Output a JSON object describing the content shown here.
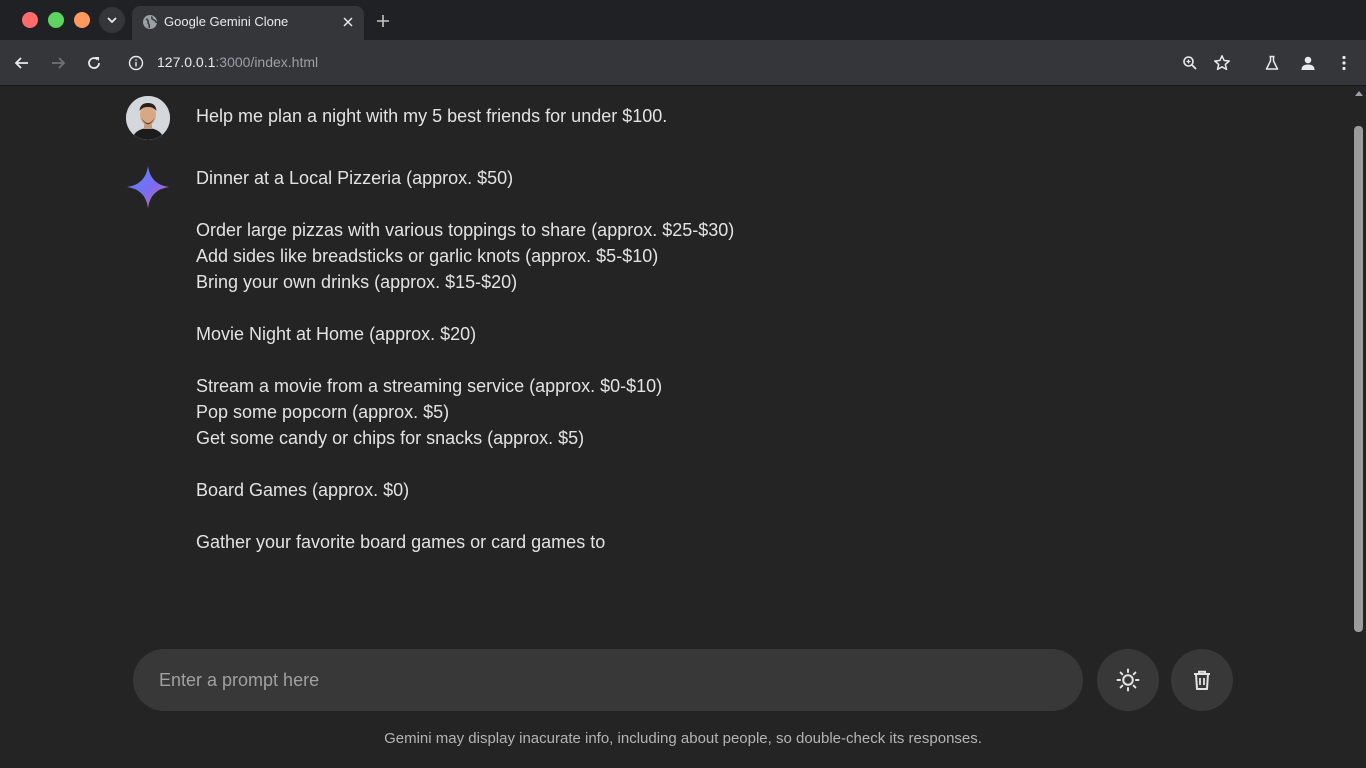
{
  "browser": {
    "tab_title": "Google Gemini Clone",
    "url_host": "127.0.0.1",
    "url_rest": ":3000/index.html"
  },
  "chat": {
    "user_message": "Help me plan a night with my 5 best friends for under $100.",
    "response_lines": [
      "Dinner at a Local Pizzeria (approx. $50)",
      "Order large pizzas with various toppings to share (approx. $25-$30)",
      "Add sides like breadsticks or garlic knots (approx. $5-$10)",
      "Bring your own drinks (approx. $15-$20)",
      "Movie Night at Home (approx. $20)",
      "Stream a movie from a streaming service (approx. $0-$10)",
      "Pop some popcorn (approx. $5)",
      "Get some candy or chips for snacks (approx. $5)",
      "Board Games (approx. $0)",
      "Gather your favorite board games or card games to"
    ]
  },
  "input": {
    "placeholder": "Enter a prompt here",
    "value": ""
  },
  "footer": {
    "disclaimer": "Gemini may display inacurate info, including about people, so double-check its responses."
  },
  "icons": {
    "theme_toggle": "sun-icon",
    "delete_chat": "trash-icon"
  }
}
